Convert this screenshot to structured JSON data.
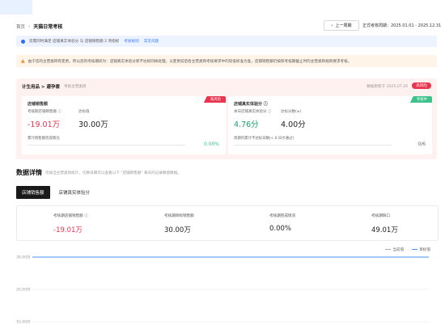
{
  "breadcrumb": {
    "home": "首页",
    "current": "天猫日常考核"
  },
  "toolbar": {
    "prev_label": "上一周期",
    "period": "正式考核周期：2025.01.01 - 2025.12.31"
  },
  "info_bar": {
    "text": "您需同时满足 店铺真实体验分 与 店铺销售额 2 项指标",
    "link1": "考核规则",
    "link2": "常见问题"
  },
  "warn_bar": {
    "text": "由于您的主营类目有变更，所以您的考核期间为：店铺真实体验分新不达标同样处理，以变更前后各主营类目考核要求中的较低标准为准，店铺销售额仍按照考核期截止时的主营类目规则要求考核。"
  },
  "card": {
    "path": "计生用品 > 避孕套",
    "sub": "考核主营类目",
    "date": "数据更新于 2025.07.26",
    "badge": "高风险",
    "panel1": {
      "title": "店铺销售额",
      "tag": "高风险",
      "label_a": "考核期店铺销售额 ⓘ",
      "label_b": "达标值",
      "value_a": "-19.01万",
      "value_b": "30.00万",
      "note": "累计销售额完成情况",
      "pct": "0.00%"
    },
    "panel2": {
      "title": "店铺真实体验分 ⓘ",
      "tag": "考核中",
      "label_a": "本日店铺真实体验分 ⓘ",
      "label_b": "达标分数(≥)",
      "value_a": "4.76分",
      "value_b": "4.00分",
      "note": "周期内累计不达标日数(< 6 日才通过)",
      "pct": "0/6"
    }
  },
  "details": {
    "title": "数据详情",
    "desc": "仅按当主营类目统计，切换日期可以查看以下 \"店铺销售额\" 每天的记录数值数据。",
    "tabs": [
      "店铺销售额",
      "店铺真实体验分"
    ],
    "metrics": [
      {
        "label": "考核期店铺销售额 ⓘ",
        "value": "-19.01万"
      },
      {
        "label": "考核期目标销售额",
        "value": "30.00万"
      },
      {
        "label": "考核期完成情况",
        "value": "0.00%"
      },
      {
        "label": "考核期缺口",
        "value": "49.01万"
      }
    ],
    "legend": [
      "当前值",
      "目标值"
    ]
  },
  "chart_data": {
    "type": "line",
    "y_ticks": [
      "30.00万",
      "20.00万",
      "10.00万"
    ],
    "series": [
      {
        "name": "目标值",
        "values": [
          30,
          30
        ]
      }
    ],
    "colors": {
      "target": "#4a8cff",
      "grid": "#e8e8e8"
    }
  },
  "colors": {
    "accent": "#2f6bff",
    "danger": "#e8344e",
    "success": "#3cc28a"
  }
}
